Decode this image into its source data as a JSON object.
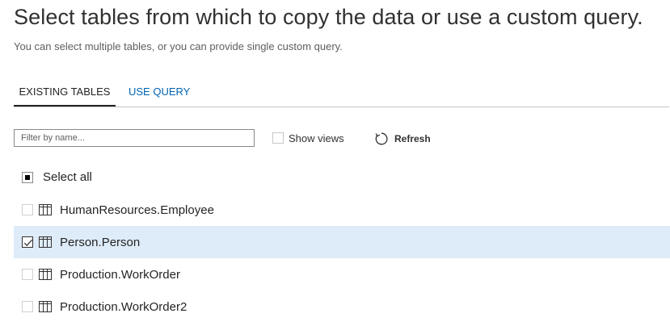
{
  "header": {
    "title": "Select tables from which to copy the data or use a custom query.",
    "subtitle": "You can select multiple tables, or you can provide single custom query."
  },
  "tabs": [
    {
      "label": "EXISTING TABLES",
      "active": true
    },
    {
      "label": "USE QUERY",
      "active": false
    }
  ],
  "filter": {
    "placeholder": "Filter by name...",
    "value": ""
  },
  "show_views": {
    "label": "Show views",
    "checked": false
  },
  "refresh": {
    "label": "Refresh",
    "icon": "refresh-icon"
  },
  "select_all": {
    "label": "Select all",
    "state": "indeterminate"
  },
  "tables": [
    {
      "name": "HumanResources.Employee",
      "checked": false,
      "icon": "table-icon"
    },
    {
      "name": "Person.Person",
      "checked": true,
      "icon": "table-icon"
    },
    {
      "name": "Production.WorkOrder",
      "checked": false,
      "icon": "table-icon"
    },
    {
      "name": "Production.WorkOrder2",
      "checked": false,
      "icon": "table-icon"
    }
  ],
  "colors": {
    "accent_link": "#0063b1",
    "selected_row": "#deecf9",
    "text": "#252423"
  }
}
